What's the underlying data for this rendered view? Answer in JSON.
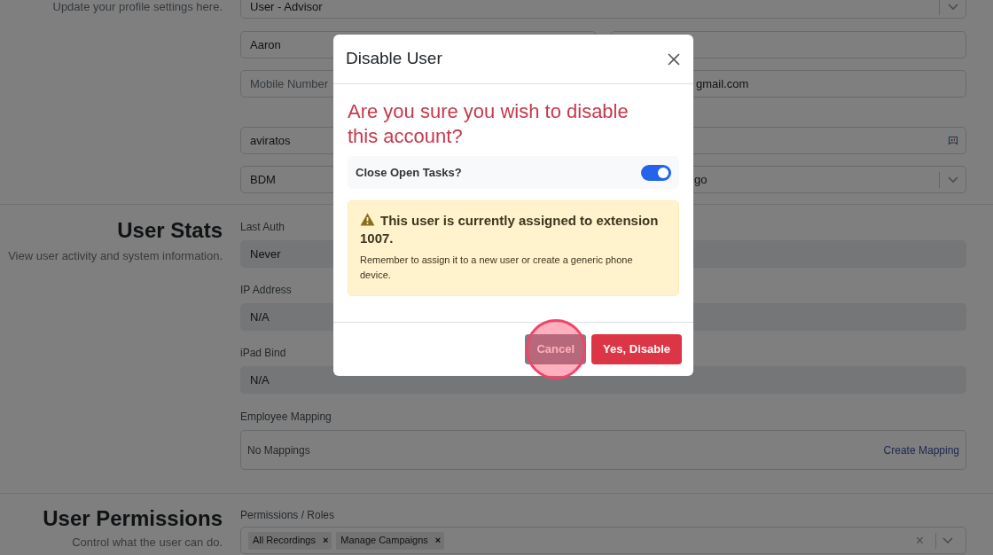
{
  "profile": {
    "description": "Update your profile settings here.",
    "rows": [
      [
        {
          "kind": "select",
          "value": "User - Advisor"
        }
      ],
      [
        {
          "kind": "input",
          "value": "Aaron"
        },
        {
          "kind": "input"
        }
      ],
      [
        {
          "kind": "input",
          "placeholder": "Mobile Number"
        },
        {
          "kind": "obscured",
          "value": "gmail.com"
        }
      ],
      [
        {
          "kind": "input-icon",
          "value": "aviratos"
        }
      ],
      [
        {
          "kind": "input",
          "value": "BDM"
        },
        {
          "kind": "obscured-select",
          "value": "go"
        }
      ]
    ]
  },
  "stats": {
    "title": "User Stats",
    "description": "View user activity and system information.",
    "fields": [
      {
        "label": "Last Auth",
        "value": "Never"
      },
      {
        "label": "IP Address",
        "value": "N/A"
      },
      {
        "label": "iPad Bind",
        "value": "N/A"
      }
    ],
    "mapping": {
      "label": "Employee Mapping",
      "empty_text": "No Mappings",
      "link": "Create Mapping"
    }
  },
  "permissions": {
    "title": "User Permissions",
    "description": "Control what the user can do.",
    "label": "Permissions / Roles",
    "tags": [
      "All Recordings",
      "Manage Campaigns"
    ],
    "tag_remove": "×",
    "clear": "×"
  },
  "dialog": {
    "title": "Disable User",
    "question": "Are you sure you wish to disable this account?",
    "toggle": {
      "label": "Close Open Tasks?",
      "on": true
    },
    "alert": {
      "heading": "This user is currently assigned to extension 1007.",
      "text": "Remember to assign it to a new user or create a generic phone device."
    },
    "buttons": [
      {
        "label": "Cancel",
        "kind": "secondary",
        "highlighted": true
      },
      {
        "label": "Yes, Disable",
        "kind": "danger",
        "highlighted": false
      }
    ]
  }
}
